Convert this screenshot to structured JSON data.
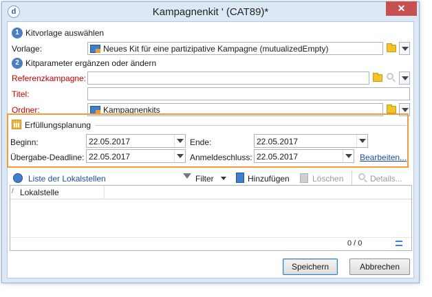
{
  "window": {
    "title": "Kampagnenkit '  (CAT89)*",
    "app_icon_letter": "d",
    "close_glyph": "✕"
  },
  "section1": {
    "number": "1",
    "heading": "Kitvorlage auswählen"
  },
  "vorlage": {
    "label": "Vorlage:",
    "value": "Neues Kit für eine partizipative Kampagne (mutualizedEmpty)"
  },
  "section2": {
    "number": "2",
    "heading": "Kitparameter ergänzen oder ändern"
  },
  "referenz": {
    "label": "Referenzkampagne:",
    "value": ""
  },
  "titel": {
    "label": "Titel:",
    "value": ""
  },
  "ordner": {
    "label": "Ordner:",
    "value": "Kampagnenkits"
  },
  "planning": {
    "heading": "Erfüllungsplanung",
    "beginn": {
      "label": "Beginn:",
      "value": "22.05.2017"
    },
    "ende": {
      "label": "Ende:",
      "value": "22.05.2017"
    },
    "uebergabe": {
      "label": "Übergabe-Deadline:",
      "value": "22.05.2017"
    },
    "anmelde": {
      "label": "Anmeldeschluss:",
      "value": "22.05.2017"
    },
    "edit_link": "Bearbeiten..."
  },
  "toolbar": {
    "list_label": "Liste der Lokalstellen",
    "filter_label": "Filter",
    "add_label": "Hinzufügen",
    "delete_label": "Löschen",
    "details_label": "Details..."
  },
  "table": {
    "sort_marker": "/",
    "column": "Lokalstelle",
    "count": "0 / 0"
  },
  "buttons": {
    "save": "Speichern",
    "cancel": "Abbrechen"
  },
  "colors": {
    "highlight": "#f39a3a",
    "required_label": "#c00000",
    "link": "#1a4fa8"
  }
}
